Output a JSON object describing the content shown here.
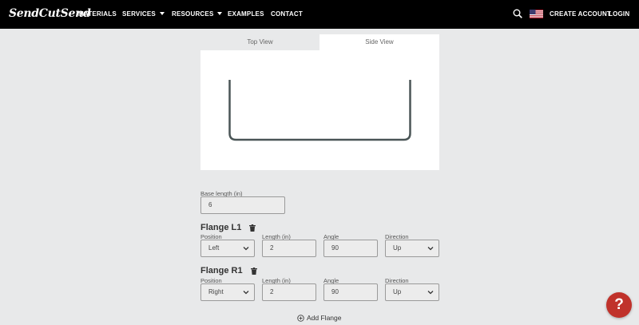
{
  "header": {
    "logo": "SendCutSend",
    "nav": [
      {
        "label": "MATERIALS",
        "dropdown": false
      },
      {
        "label": "SERVICES",
        "dropdown": true
      },
      {
        "label": "RESOURCES",
        "dropdown": true
      },
      {
        "label": "EXAMPLES",
        "dropdown": false
      },
      {
        "label": "CONTACT",
        "dropdown": false
      }
    ],
    "search_icon": "search-icon",
    "flag_icon": "us-flag-icon",
    "create_account": "CREATE ACCOUNT",
    "login": "LOGIN"
  },
  "view_tabs": {
    "top": "Top View",
    "side": "Side View",
    "selected": "Side View"
  },
  "base": {
    "label": "Base length (in)",
    "value": "6"
  },
  "flanges": [
    {
      "title": "Flange L1",
      "position_label": "Position",
      "position": "Left",
      "length_label": "Length (in)",
      "length": "2",
      "angle_label": "Angle",
      "angle": "90",
      "direction_label": "Direction",
      "direction": "Up"
    },
    {
      "title": "Flange R1",
      "position_label": "Position",
      "position": "Right",
      "length_label": "Length (in)",
      "length": "2",
      "angle_label": "Angle",
      "angle": "90",
      "direction_label": "Direction",
      "direction": "Up"
    }
  ],
  "add_flange": "Add Flange",
  "help": "?",
  "colors": {
    "nav_bg": "#000000",
    "page_bg": "#e8e9ea",
    "help_button": "#c0322b",
    "part_stroke": "#4a5556"
  }
}
